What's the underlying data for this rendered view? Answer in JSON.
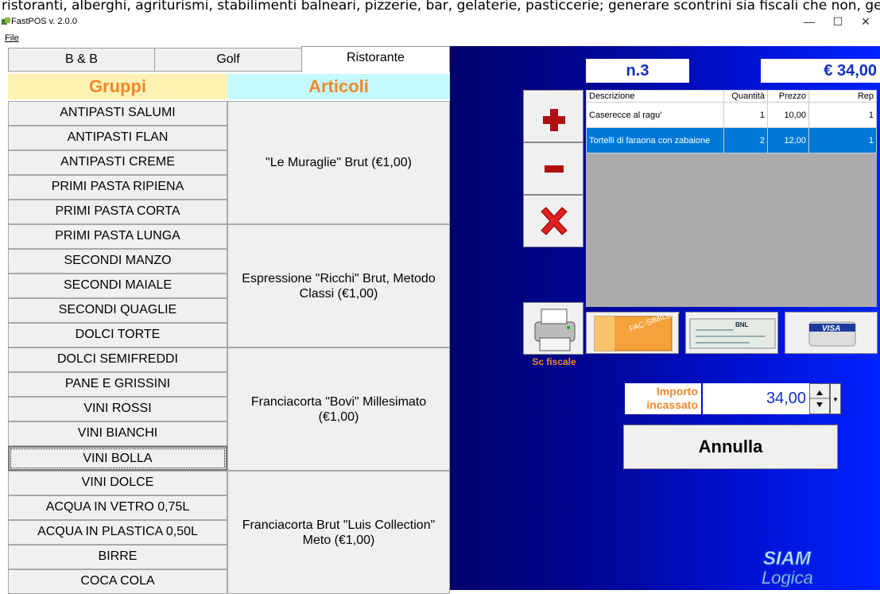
{
  "top_strip_text": "ristoranti, alberghi, agriturismi, stabilimenti balneari, pizzerie, bar, gelaterie, pasticcerie; generare scontrini sia fiscali che non, gestire direttamente il display e la stampa della ricevuta",
  "window": {
    "title": "FastPOS v. 2.0.0",
    "minimize": "—",
    "maximize": "☐",
    "close": "✕"
  },
  "menu": {
    "file": "File"
  },
  "tabs": [
    "B & B",
    "Golf",
    "Ristorante"
  ],
  "headers": {
    "gruppi": "Gruppi",
    "articoli": "Articoli"
  },
  "groups": [
    "ANTIPASTI SALUMI",
    "ANTIPASTI FLAN",
    "ANTIPASTI CREME",
    "PRIMI PASTA RIPIENA",
    "PRIMI PASTA CORTA",
    "PRIMI PASTA LUNGA",
    "SECONDI MANZO",
    "SECONDI MAIALE",
    "SECONDI QUAGLIE",
    "DOLCI TORTE",
    "DOLCI SEMIFREDDI",
    "PANE E GRISSINI",
    "VINI ROSSI",
    "VINI BIANCHI",
    "VINI BOLLA",
    "VINI DOLCE",
    "ACQUA IN VETRO 0,75L",
    "ACQUA IN PLASTICA 0,50L",
    "BIRRE",
    "COCA COLA"
  ],
  "articles": [
    "\"Le Muraglie\" Brut  (€1,00)",
    "Espressione \"Ricchi\" Brut, Metodo Classi (€1,00)",
    "Franciacorta \"Bovi\" Millesimato (€1,00)",
    "Franciacorta Brut \"Luis Collection\" Meto (€1,00)"
  ],
  "ticket": {
    "number": "n.3",
    "total": "€ 34,00"
  },
  "grid": {
    "columns": [
      "Descrizione",
      "Quantità",
      "Prezzo",
      "Rep"
    ],
    "rows": [
      [
        "Caserecce al ragu'",
        "1",
        "10,00",
        "1"
      ],
      [
        "Tortelli di faraona con zabaione",
        "2",
        "12,00",
        "1"
      ]
    ]
  },
  "payment": {
    "print_label": "Sc fiscale",
    "cash_label": "FAC-SIMILE 50",
    "check_label": "BNL",
    "card_label": "VISA"
  },
  "importo": {
    "label": "Importo incassato",
    "value": "34,00"
  },
  "annulla": "Annulla",
  "logo": "SIAM Logica"
}
